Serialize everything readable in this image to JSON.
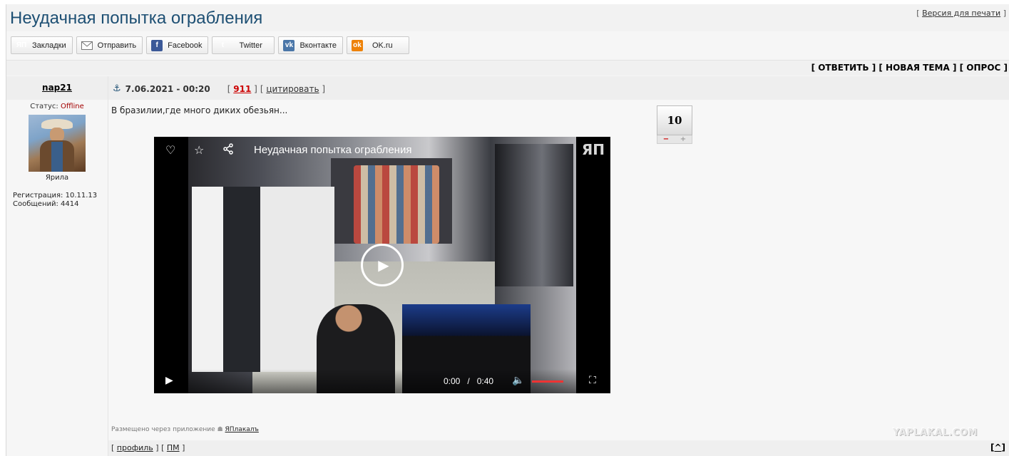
{
  "page": {
    "title": "Неудачная попытка ограбления",
    "print_link": "Версия для печати"
  },
  "share": [
    {
      "label": "Закладки",
      "icon": "yap-bookmark-icon",
      "glyph": "ЯП"
    },
    {
      "label": "Отправить",
      "icon": "mail-icon",
      "glyph": "✉"
    },
    {
      "label": "Facebook",
      "icon": "facebook-icon",
      "glyph": "f"
    },
    {
      "label": "Twitter",
      "icon": "twitter-icon",
      "glyph": "t"
    },
    {
      "label": "Вконтакте",
      "icon": "vk-icon",
      "glyph": "vk"
    },
    {
      "label": "OK.ru",
      "icon": "ok-icon",
      "glyph": "ok"
    }
  ],
  "actions": {
    "reply": "ОТВЕТИТЬ",
    "new_topic": "НОВАЯ ТЕМА",
    "poll": "ОПРОС"
  },
  "post": {
    "author": "nap21",
    "status_label": "Статус:",
    "status": "Offline",
    "avatar_caption": "Ярила",
    "registration": "Регистрация: 10.11.13",
    "messages": "Сообщений: 4414",
    "date": "7.06.2021 - 00:20",
    "number": "911",
    "quote_label": "цитировать",
    "text": "В бразилии,где много диких обезьян...",
    "rating": "10",
    "rating_minus": "−",
    "rating_plus": "+",
    "via_text": "Размещено через приложение",
    "via_app": "ЯПлакалъ"
  },
  "video": {
    "title": "Неудачная попытка ограбления",
    "time_current": "0:00",
    "time_sep": "/",
    "time_total": "0:40",
    "logo": "ЯП"
  },
  "footer": {
    "profile": "профиль",
    "pm": "ПМ",
    "top": "^"
  },
  "watermark": "YAPLAKAL.COM"
}
